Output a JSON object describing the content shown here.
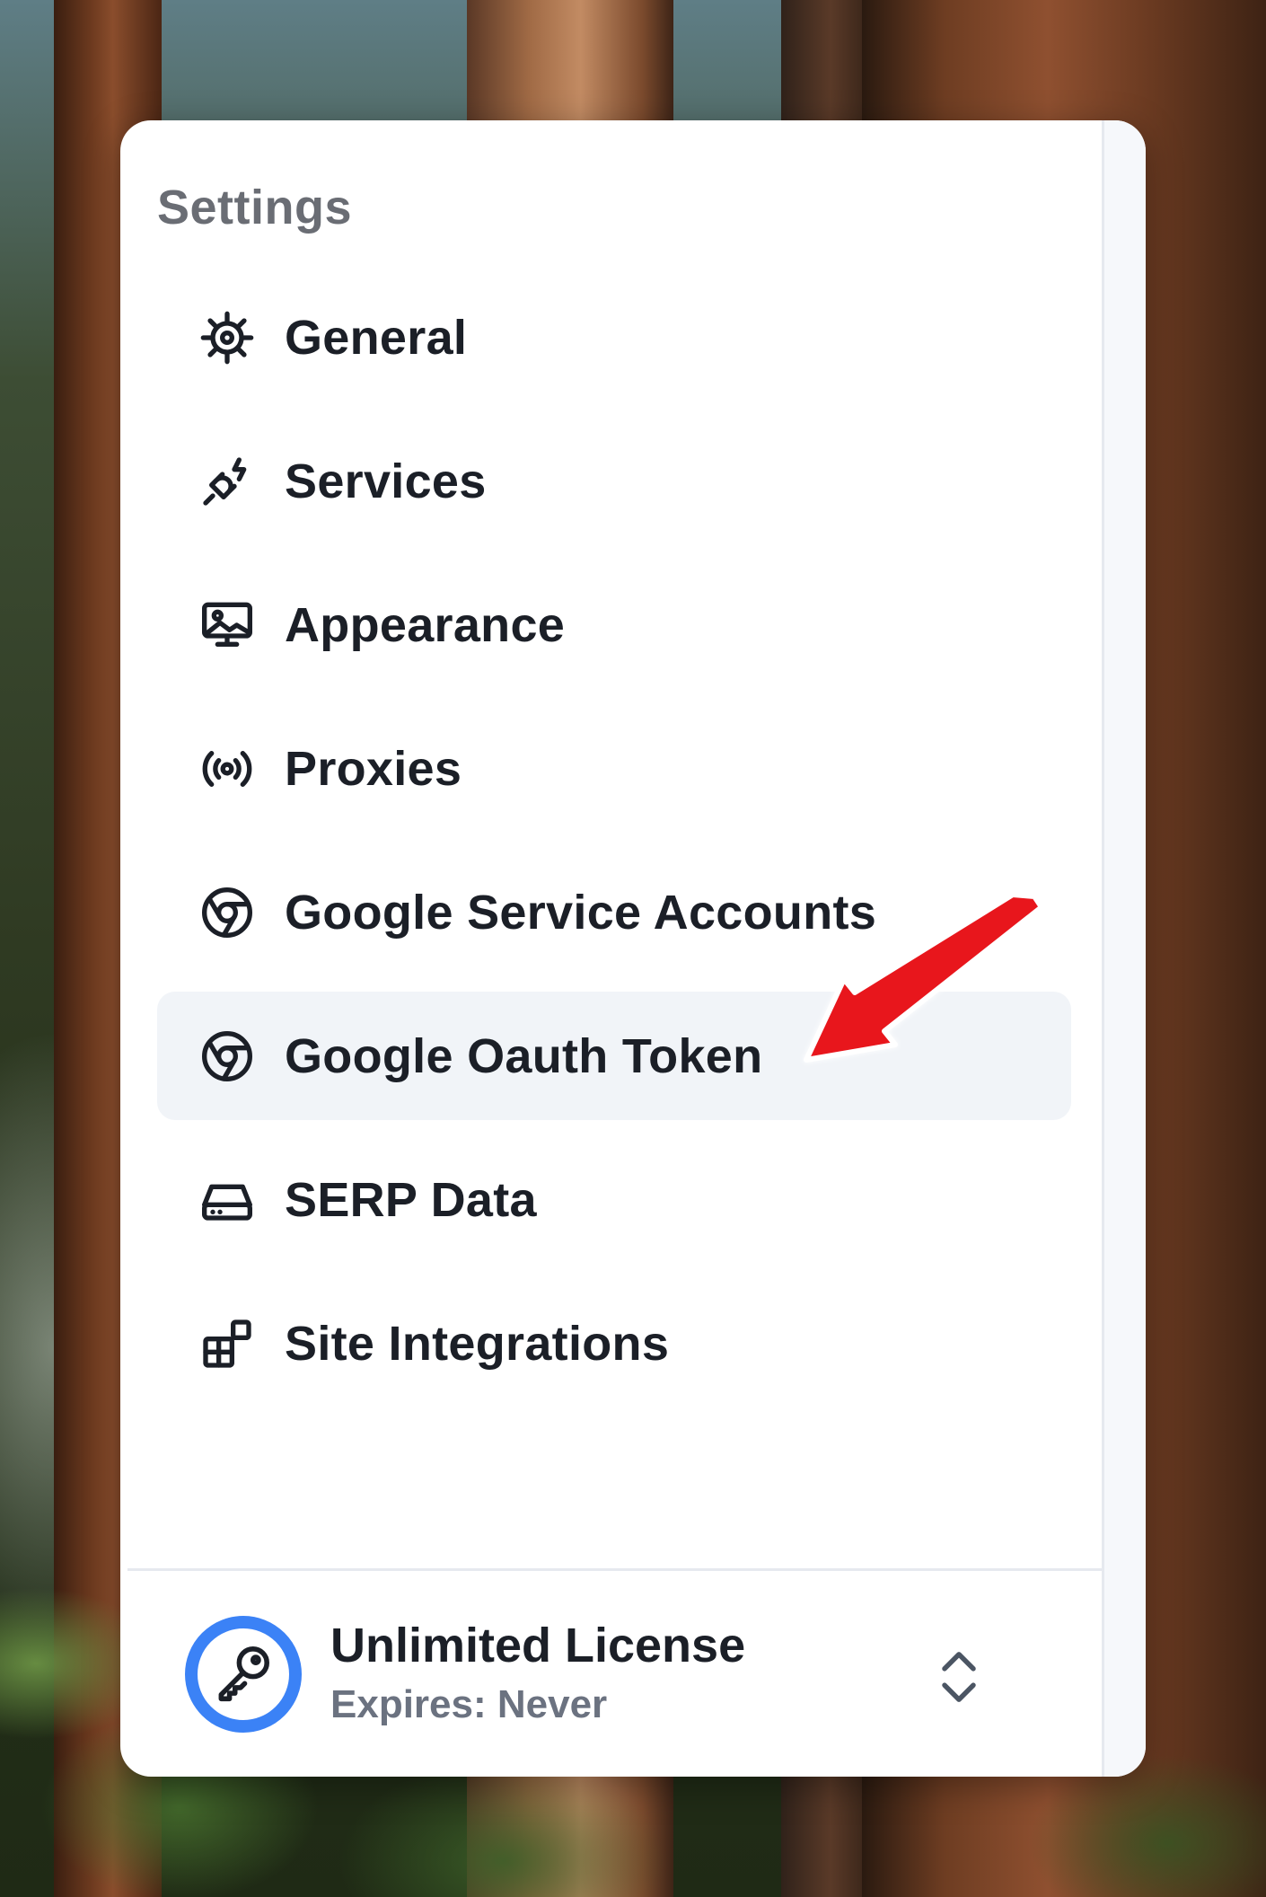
{
  "settings": {
    "title": "Settings",
    "items": [
      {
        "label": "General",
        "icon": "gear-icon"
      },
      {
        "label": "Services",
        "icon": "plug-icon"
      },
      {
        "label": "Appearance",
        "icon": "monitor-image-icon"
      },
      {
        "label": "Proxies",
        "icon": "broadcast-icon"
      },
      {
        "label": "Google Service Accounts",
        "icon": "chrome-icon"
      },
      {
        "label": "Google Oauth Token",
        "icon": "chrome-icon",
        "active": true
      },
      {
        "label": "SERP Data",
        "icon": "hard-drive-icon"
      },
      {
        "label": "Site Integrations",
        "icon": "apps-add-icon"
      }
    ]
  },
  "license": {
    "name": "Unlimited License",
    "expires": "Expires: Never",
    "icon": "key-icon",
    "accent_color": "#3b82f6"
  },
  "annotation": {
    "arrow_color": "#e8141b",
    "points_to": "Google Oauth Token"
  }
}
